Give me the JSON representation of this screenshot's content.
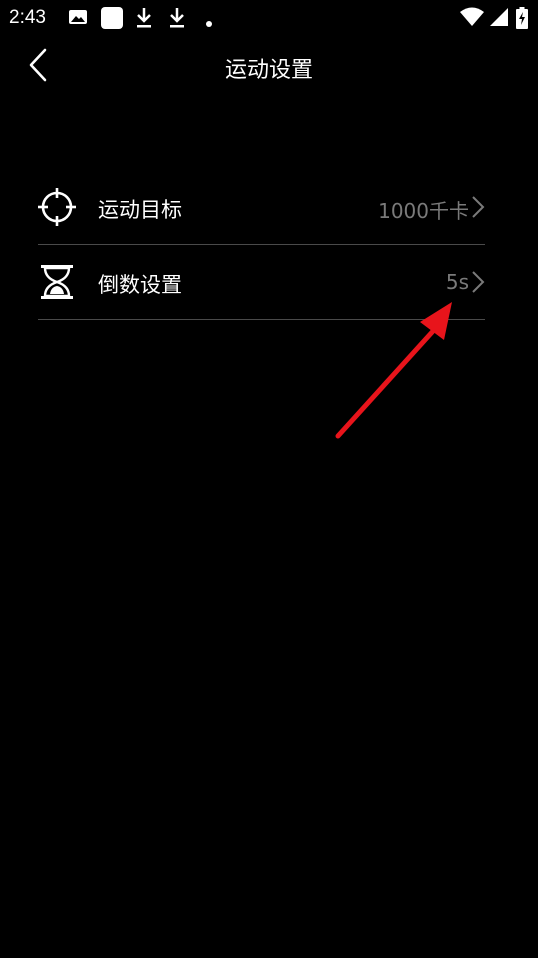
{
  "status_bar": {
    "time": "2:43",
    "icons": [
      "image-icon",
      "square-app-icon",
      "download-icon",
      "download-icon",
      "dot-icon"
    ],
    "right_icons": [
      "wifi-icon",
      "signal-icon",
      "battery-charging-icon"
    ]
  },
  "header": {
    "title": "运动设置",
    "back_icon": "chevron-left-icon"
  },
  "settings": [
    {
      "icon": "crosshair-icon",
      "label": "运动目标",
      "value": "1000千卡",
      "chevron": "chevron-right-icon"
    },
    {
      "icon": "hourglass-icon",
      "label": "倒数设置",
      "value": "5s",
      "chevron": "chevron-right-icon"
    }
  ],
  "colors": {
    "background": "#000000",
    "text": "#ffffff",
    "value_text": "#7a7a7a",
    "divider": "#4a4a4a",
    "annotation_arrow": "#e8141b"
  }
}
